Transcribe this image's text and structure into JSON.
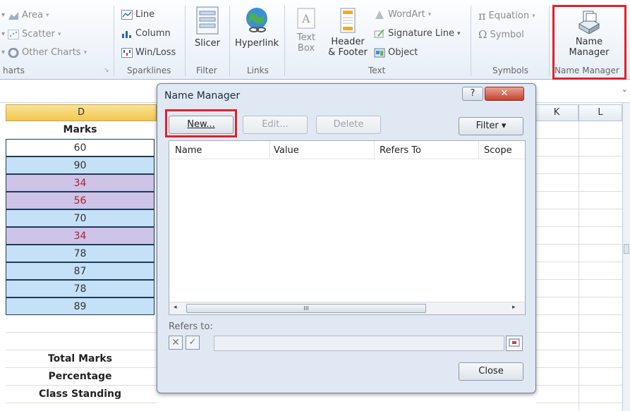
{
  "ribbon": {
    "charts": {
      "area": "Area",
      "scatter": "Scatter",
      "other_charts": "Other Charts",
      "group": "harts"
    },
    "sparklines": {
      "line": "Line",
      "column": "Column",
      "win_loss": "Win/Loss",
      "group": "Sparklines"
    },
    "filter": {
      "slicer": "Slicer",
      "group": "Filter"
    },
    "links": {
      "hyperlink": "Hyperlink",
      "group": "Links"
    },
    "text": {
      "text_box_1": "Text",
      "text_box_2": "Box",
      "header_1": "Header",
      "header_2": "& Footer",
      "wordart": "WordArt",
      "signature_line": "Signature Line",
      "object": "Object",
      "group": "Text"
    },
    "symbols": {
      "equation": "Equation",
      "symbol": "Symbol",
      "group": "Symbols"
    },
    "name_manager": {
      "label_1": "Name",
      "label_2": "Manager",
      "group": "Name Manager"
    }
  },
  "grid": {
    "col_d": "D",
    "col_k": "K",
    "col_l": "L",
    "header": "Marks",
    "marks": [
      {
        "value": "60",
        "color": "white",
        "red": false
      },
      {
        "value": "90",
        "color": "blue",
        "red": false
      },
      {
        "value": "34",
        "color": "purple",
        "red": true
      },
      {
        "value": "56",
        "color": "purple",
        "red": true
      },
      {
        "value": "70",
        "color": "blue",
        "red": false
      },
      {
        "value": "34",
        "color": "purple",
        "red": true
      },
      {
        "value": "78",
        "color": "blue",
        "red": false
      },
      {
        "value": "87",
        "color": "blue",
        "red": false
      },
      {
        "value": "78",
        "color": "blue",
        "red": false
      },
      {
        "value": "89",
        "color": "blue",
        "red": false
      }
    ],
    "total_marks": "Total Marks",
    "percentage": "Percentage",
    "class_standing": "Class Standing"
  },
  "dialog": {
    "title": "Name Manager",
    "help": "?",
    "close_x": "✕",
    "new_button": "New...",
    "edit_button": "Edit...",
    "delete_button": "Delete",
    "filter_button": "Filter ▾",
    "columns": [
      "Name",
      "Value",
      "Refers To",
      "Scope"
    ],
    "scroll_grip": "III",
    "refers_to_label": "Refers to:",
    "close_button": "Close"
  },
  "colors": {
    "highlight": "#e0212c",
    "blue_cell": "#c5e1f7",
    "purple_cell": "#cdc4e8",
    "red_text": "#b01e2a"
  }
}
